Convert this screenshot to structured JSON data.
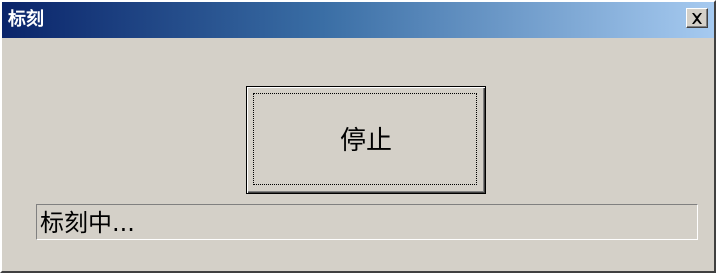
{
  "window": {
    "title": "标刻",
    "close_label": "×"
  },
  "main": {
    "stop_button_label": "停止",
    "status_text": "标刻中..."
  },
  "colors": {
    "titlebar_start": "#0a246a",
    "titlebar_end": "#a6caf0",
    "face": "#d4d0c8"
  },
  "icons": {
    "close": "close-icon"
  }
}
